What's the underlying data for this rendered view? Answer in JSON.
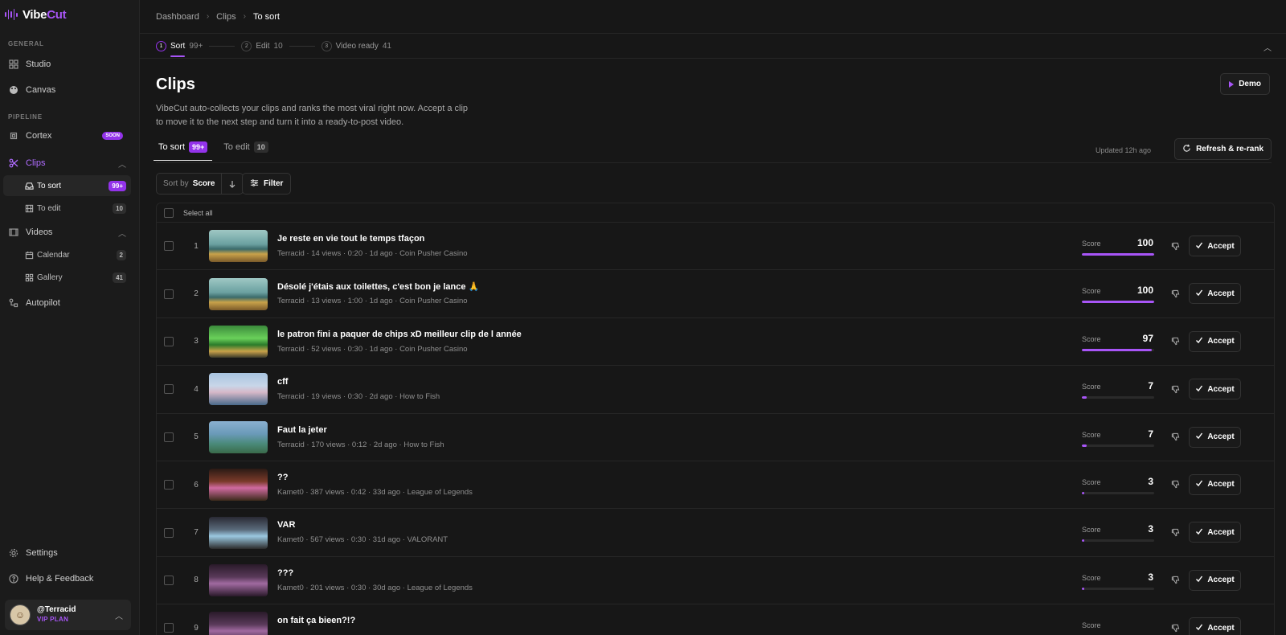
{
  "app": {
    "logo_text_a": "Vibe",
    "logo_text_b": "Cut"
  },
  "sidebar": {
    "general_label": "GENERAL",
    "pipeline_label": "PIPELINE",
    "studio": "Studio",
    "canvas": "Canvas",
    "cortex": "Cortex",
    "cortex_badge": "SOON",
    "clips": "Clips",
    "to_sort": "To sort",
    "to_sort_count": "99+",
    "to_edit": "To edit",
    "to_edit_count": "10",
    "videos": "Videos",
    "calendar": "Calendar",
    "calendar_count": "2",
    "gallery": "Gallery",
    "gallery_count": "41",
    "autopilot": "Autopilot",
    "settings": "Settings",
    "help": "Help & Feedback",
    "user_name": "@Terracid",
    "user_plan": "VIP PLAN"
  },
  "breadcrumb": {
    "a": "Dashboard",
    "b": "Clips",
    "c": "To sort"
  },
  "stepper": {
    "s1_num": "1",
    "s1_label": "Sort",
    "s1_count": "99+",
    "s2_num": "2",
    "s2_label": "Edit",
    "s2_count": "10",
    "s3_num": "3",
    "s3_label": "Video ready",
    "s3_count": "41"
  },
  "page": {
    "title": "Clips",
    "description": "VibeCut auto-collects your clips and ranks the most viral right now. Accept a clip to move it to the next step and turn it into a ready-to-post video.",
    "demo": "Demo",
    "tab_sort": "To sort",
    "tab_sort_count": "99+",
    "tab_edit": "To edit",
    "tab_edit_count": "10",
    "updated": "Updated 12h ago",
    "refresh": "Refresh & re-rank",
    "sort_by_label": "Sort by",
    "sort_by_value": "Score",
    "filter": "Filter",
    "select_all": "Select all"
  },
  "clips": [
    {
      "rank": "1",
      "title": "Je reste en vie tout le temps tfaçon",
      "meta": "Terracid · 14 views · 0:20 · 1d ago · Coin Pusher Casino",
      "score": "100",
      "score_pct": 100,
      "thumb": "casino"
    },
    {
      "rank": "2",
      "title": "Désolé j'étais aux toilettes, c'est bon je lance 🙏",
      "meta": "Terracid · 13 views · 1:00 · 1d ago · Coin Pusher Casino",
      "score": "100",
      "score_pct": 100,
      "thumb": "casino"
    },
    {
      "rank": "3",
      "title": "le patron fini a paquer de chips xD meilleur clip de l année",
      "meta": "Terracid · 52 views · 0:30 · 1d ago · Coin Pusher Casino",
      "score": "97",
      "score_pct": 97,
      "thumb": "green"
    },
    {
      "rank": "4",
      "title": "cff",
      "meta": "Terracid · 19 views · 0:30 · 2d ago · How to Fish",
      "score": "7",
      "score_pct": 7,
      "thumb": "fish"
    },
    {
      "rank": "5",
      "title": "Faut la jeter",
      "meta": "Terracid · 170 views · 0:12 · 2d ago · How to Fish",
      "score": "7",
      "score_pct": 7,
      "thumb": "fish2"
    },
    {
      "rank": "6",
      "title": "??",
      "meta": "Kamet0 · 387 views · 0:42 · 33d ago · League of Legends",
      "score": "3",
      "score_pct": 3,
      "thumb": "lol"
    },
    {
      "rank": "7",
      "title": "VAR",
      "meta": "Kamet0 · 567 views · 0:30 · 31d ago · VALORANT",
      "score": "3",
      "score_pct": 3,
      "thumb": "valo"
    },
    {
      "rank": "8",
      "title": "???",
      "meta": "Kamet0 · 201 views · 0:30 · 30d ago · League of Legends",
      "score": "3",
      "score_pct": 3,
      "thumb": "lol2"
    },
    {
      "rank": "9",
      "title": "on fait ça bieen?!?",
      "meta": "",
      "score": "",
      "score_pct": 0,
      "thumb": "lol2"
    }
  ],
  "accept_label": "Accept",
  "score_label": "Score"
}
